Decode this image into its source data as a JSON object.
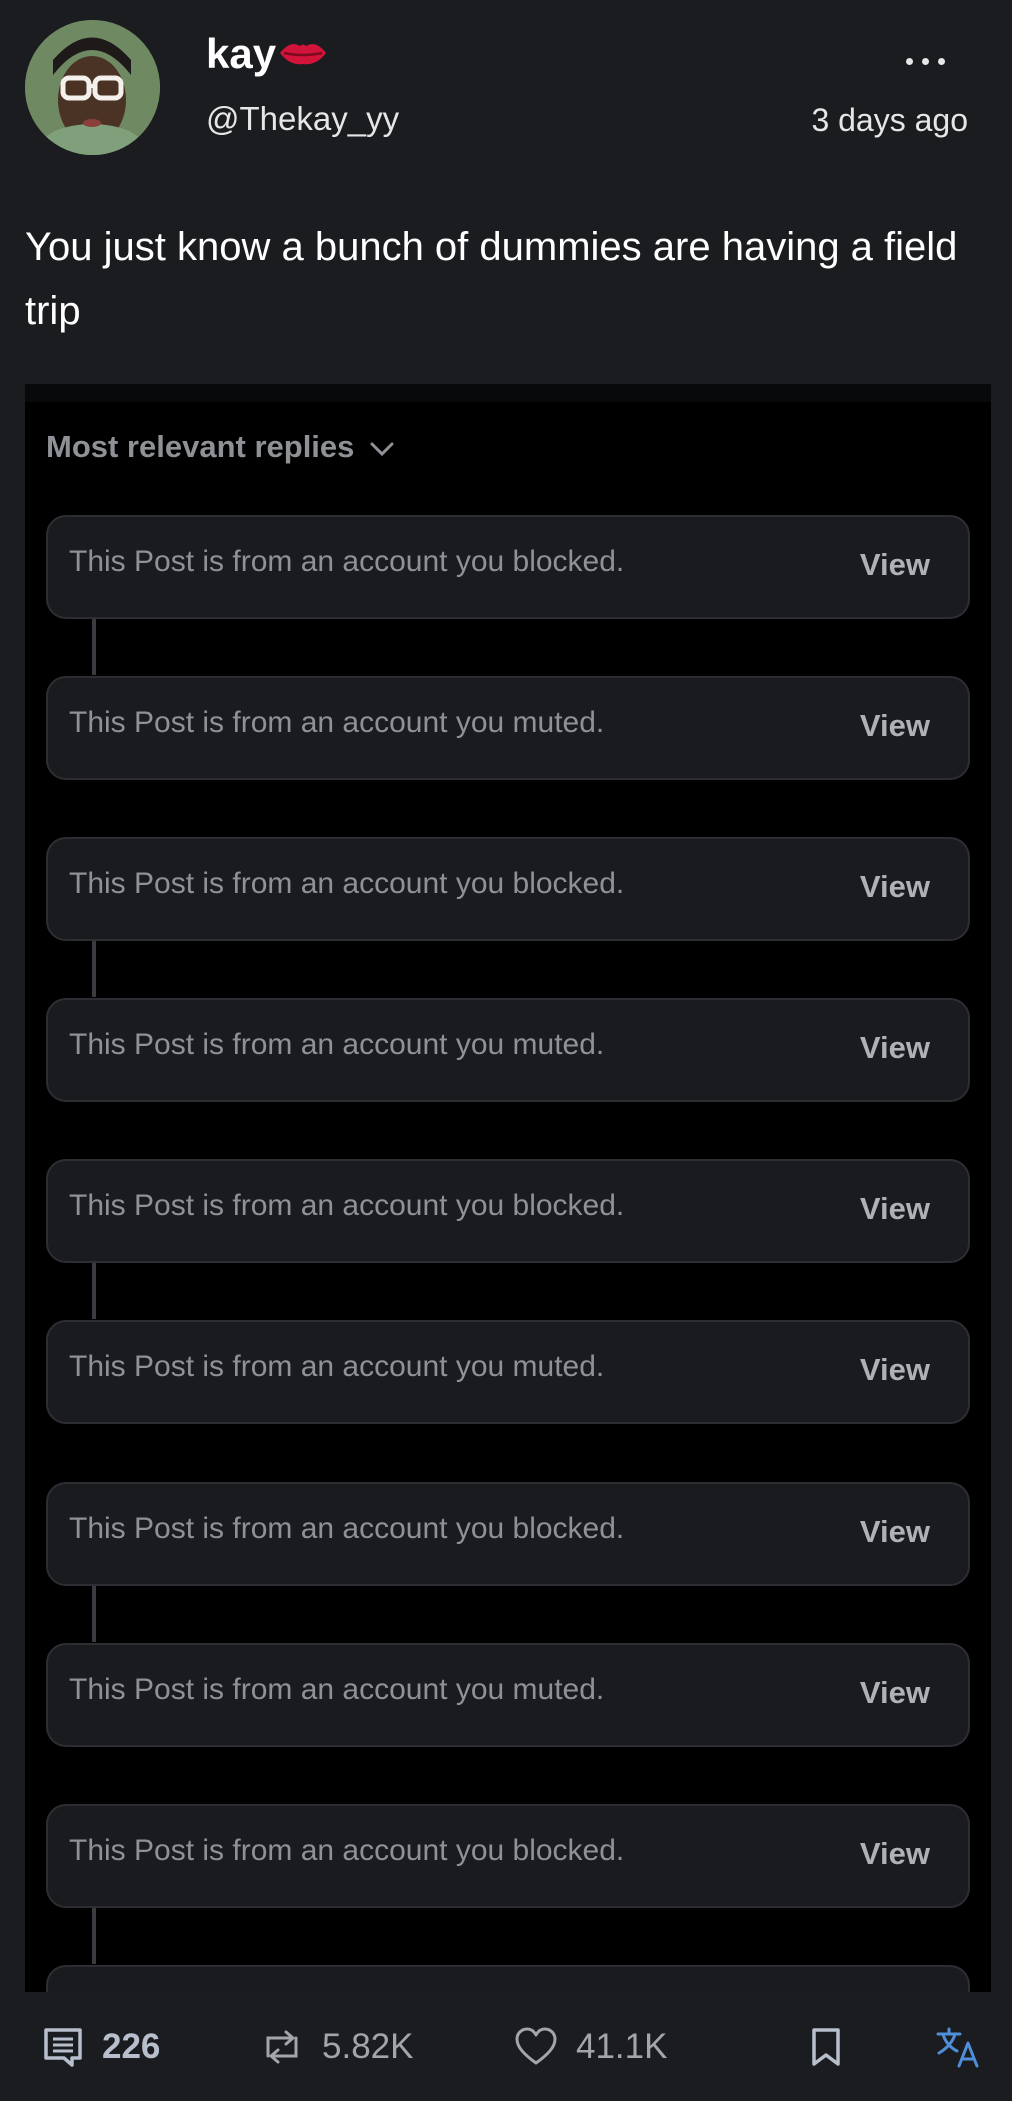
{
  "post": {
    "author_name": "kay",
    "author_handle": "@Thekay_yy",
    "timestamp": "3 days ago",
    "text": "You just know a bunch of dummies are having a field trip"
  },
  "embed": {
    "sort_label": "Most relevant replies",
    "replies": [
      {
        "text": "This Post is from an account you blocked.",
        "action": "View"
      },
      {
        "text": "This Post is from an account you muted.",
        "action": "View"
      },
      {
        "text": "This Post is from an account you blocked.",
        "action": "View"
      },
      {
        "text": "This Post is from an account you muted.",
        "action": "View"
      },
      {
        "text": "This Post is from an account you blocked.",
        "action": "View"
      },
      {
        "text": "This Post is from an account you muted.",
        "action": "View"
      },
      {
        "text": "This Post is from an account you blocked.",
        "action": "View"
      },
      {
        "text": "This Post is from an account you muted.",
        "action": "View"
      },
      {
        "text": "This Post is from an account you blocked.",
        "action": "View"
      }
    ]
  },
  "actions": {
    "replies": "226",
    "reposts": "5.82K",
    "likes": "41.1K"
  },
  "icons": {
    "more": "more-options-icon",
    "reply": "comment-icon",
    "repost": "repost-icon",
    "like": "heart-icon",
    "bookmark": "bookmark-icon",
    "translate": "translate-icon",
    "emoji": "lips-emoji"
  },
  "colors": {
    "background": "#1b1c20",
    "embed_background": "#000000",
    "card_background": "#1a1b1f",
    "accent_blue": "#4f8fd8"
  }
}
